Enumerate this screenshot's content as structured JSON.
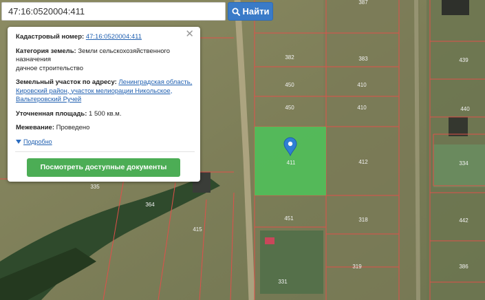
{
  "search": {
    "value": "47:16:0520004:411",
    "button_label": "Найти"
  },
  "popup": {
    "cadastral_label": "Кадастровый номер:",
    "cadastral_value": "47:16:0520004:411",
    "category_label": "Категория земель:",
    "category_value": "Земли сельскохозяйственного назначения",
    "usage_value": "дачное строительство",
    "address_label": "Земельный участок по адресу:",
    "address_value": "Ленинградская область, Кировский район, участок мелиорации Никольское, Вальтеровский Ручей",
    "area_label": "Уточненная площадь:",
    "area_value": "1 500 кв.м.",
    "survey_label": "Межевание:",
    "survey_value": "Проведено",
    "more_label": "Подробно",
    "docs_button": "Посмотреть доступные документы"
  },
  "map": {
    "parcel_labels": [
      "387",
      "382",
      "383",
      "450",
      "410",
      "450",
      "410",
      "411",
      "412",
      "451",
      "318",
      "319",
      "331",
      "335",
      "364",
      "415",
      "439",
      "440",
      "334",
      "442",
      "386"
    ],
    "colors": {
      "highlight": "#4fc15a",
      "boundary": "#e0504a",
      "marker": "#2f7fd3"
    }
  }
}
